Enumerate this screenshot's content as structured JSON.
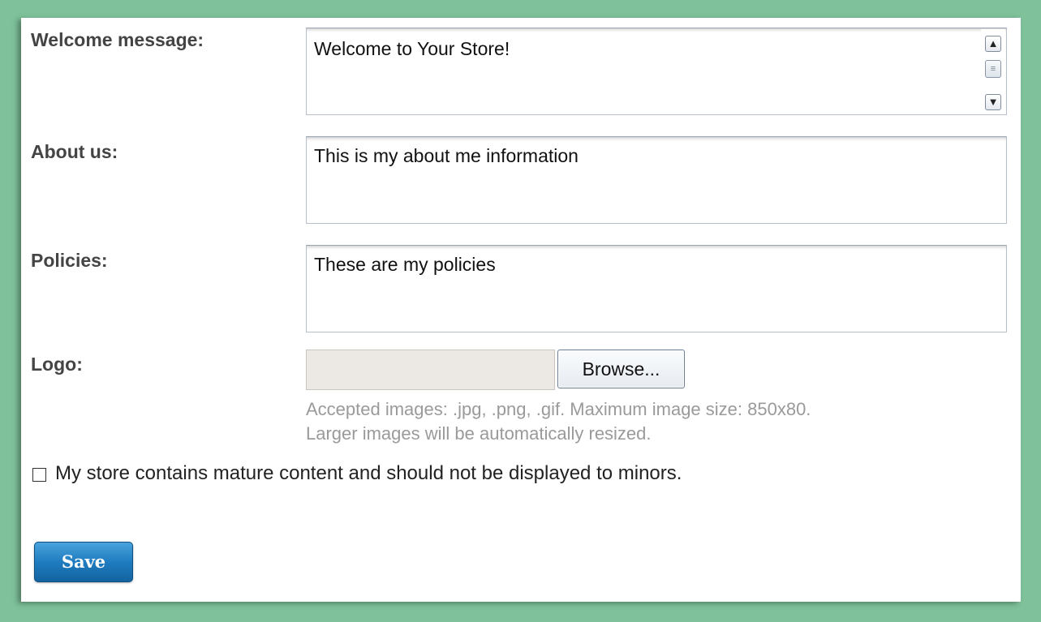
{
  "form": {
    "welcome": {
      "label": "Welcome message:",
      "value": "Welcome to Your Store!"
    },
    "about": {
      "label": "About us:",
      "value": "This is my about me information"
    },
    "policies": {
      "label": "Policies:",
      "value": "These are my policies"
    },
    "logo": {
      "label": "Logo:",
      "file_value": "",
      "browse_label": "Browse...",
      "hint_line1": "Accepted images: .jpg, .png, .gif. Maximum image size: 850x80.",
      "hint_line2": "Larger images will be automatically resized."
    },
    "mature": {
      "label": "My store contains mature content and should not be displayed to minors.",
      "checked": false
    },
    "save_label": "Save"
  },
  "icons": {
    "scroll_up": "chevron-up-icon",
    "scroll_down": "chevron-down-icon",
    "scroll_thumb": "grip-icon"
  },
  "colors": {
    "frame": "#7ec19a",
    "save_button": "#1f7cc0",
    "label_text": "#444444",
    "hint_text": "#9a9a9a"
  }
}
